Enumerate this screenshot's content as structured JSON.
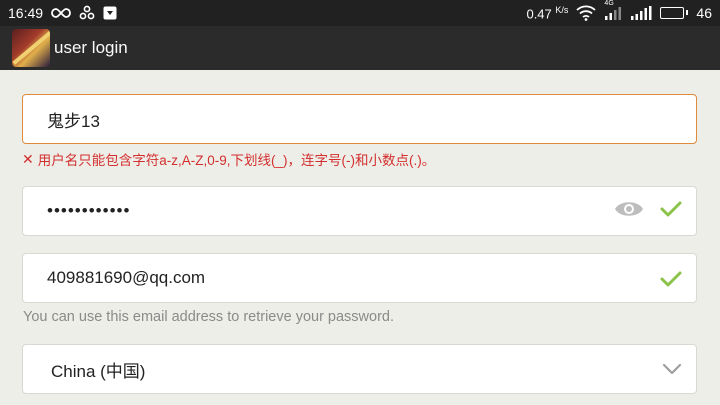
{
  "status_bar": {
    "time": "16:49",
    "speed_value": "0.47",
    "speed_unit": "K/s",
    "network_label": "4G",
    "battery_percent": "46",
    "icons": [
      "infinity-icon",
      "share-icon",
      "download-icon",
      "wifi-icon",
      "signal-icon",
      "signal-icon-2",
      "battery-icon"
    ]
  },
  "app_bar": {
    "title": "user login",
    "logo_icon": "app-logo"
  },
  "form": {
    "username": {
      "value": "鬼步13",
      "error": "用户名只能包含字符a-z,A-Z,0-9,下划线(_)，连字号(-)和小数点(.)。"
    },
    "password": {
      "value": "••••••••••••",
      "icons": [
        "eye-icon",
        "check-icon"
      ]
    },
    "email": {
      "value": "409881690@qq.com",
      "hint": "You can use this email address to retrieve your password.",
      "icons": [
        "check-icon"
      ]
    },
    "country": {
      "selected": "China (中国)",
      "icons": [
        "chevron-down-icon"
      ]
    }
  },
  "colors": {
    "error": "#d32f2f",
    "focus_border": "#e08a3c",
    "check": "#8bc34a",
    "appbar": "#2b2b2b"
  }
}
